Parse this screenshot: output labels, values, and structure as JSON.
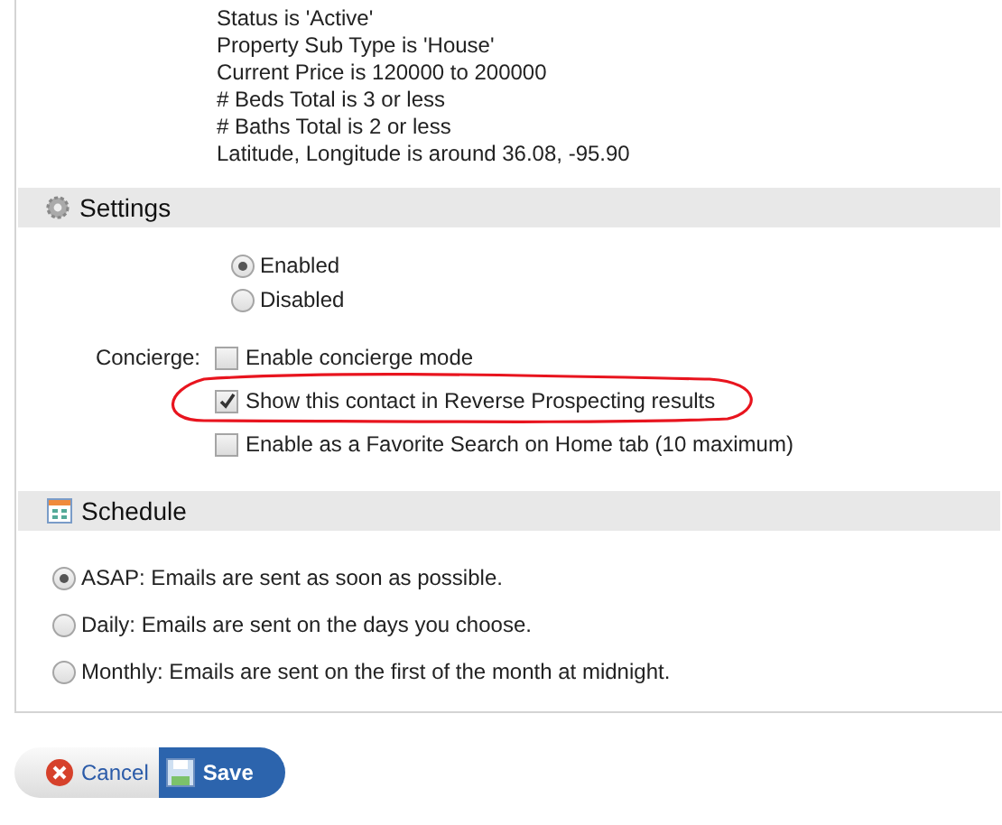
{
  "criteria": [
    "Status is 'Active'",
    "Property Sub Type is 'House'",
    "Current Price is 120000 to 200000",
    "# Beds Total is 3 or less",
    "# Baths Total is 2 or less",
    "Latitude, Longitude is around 36.08, -95.90"
  ],
  "settings": {
    "title": "Settings",
    "status_options": [
      {
        "label": "Enabled",
        "selected": true
      },
      {
        "label": "Disabled",
        "selected": false
      }
    ],
    "concierge_label": "Concierge:",
    "options": [
      {
        "label": "Enable concierge mode",
        "checked": false,
        "highlighted": false
      },
      {
        "label": "Show this contact in Reverse Prospecting results",
        "checked": true,
        "highlighted": true
      },
      {
        "label": "Enable as a Favorite Search on Home tab (10 maximum)",
        "checked": false,
        "highlighted": false
      }
    ]
  },
  "schedule": {
    "title": "Schedule",
    "options": [
      {
        "label": "ASAP: Emails are sent as soon as possible.",
        "selected": true
      },
      {
        "label": "Daily: Emails are sent on the days you choose.",
        "selected": false
      },
      {
        "label": "Monthly: Emails are sent on the first of the month at midnight.",
        "selected": false
      }
    ]
  },
  "buttons": {
    "cancel": "Cancel",
    "save": "Save"
  }
}
